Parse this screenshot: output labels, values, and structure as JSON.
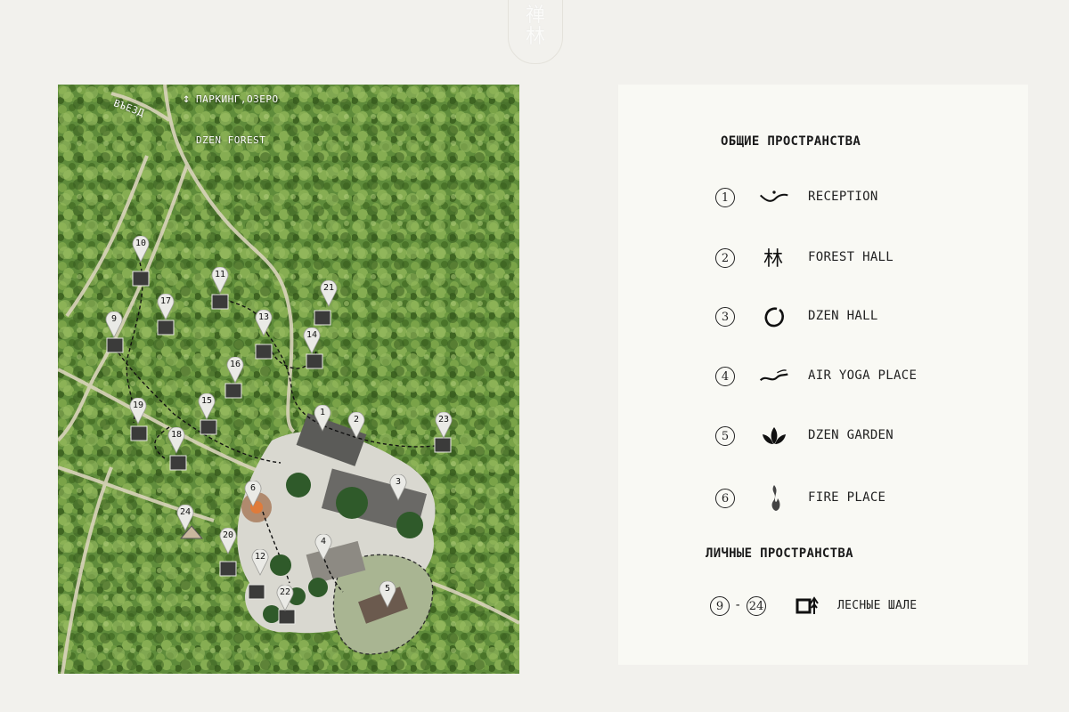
{
  "logo": {
    "line1": "禅",
    "line2": "林"
  },
  "map": {
    "entry_label": "ВЪЕЗД",
    "direction_up": "ПАРКИНГ,ОЗЕРО",
    "direction_down": "DZEN FOREST",
    "markers": [
      "1",
      "2",
      "3",
      "4",
      "5",
      "6",
      "9",
      "10",
      "11",
      "12",
      "13",
      "14",
      "15",
      "16",
      "17",
      "18",
      "19",
      "20",
      "21",
      "22",
      "23",
      "24"
    ]
  },
  "legend": {
    "common_title": "ОБЩИЕ ПРОСТРАНСТВА",
    "items": [
      {
        "num": "1",
        "label": "RECEPTION",
        "icon": "reception-icon"
      },
      {
        "num": "2",
        "label": "FOREST HALL",
        "icon": "forest-hall-icon"
      },
      {
        "num": "3",
        "label": "DZEN HALL",
        "icon": "enso-circle-icon"
      },
      {
        "num": "4",
        "label": "AIR YOGA PLACE",
        "icon": "air-wave-icon"
      },
      {
        "num": "5",
        "label": "DZEN GARDEN",
        "icon": "lotus-icon"
      },
      {
        "num": "6",
        "label": "FIRE PLACE",
        "icon": "flame-icon"
      }
    ],
    "private_title": "ЛИЧНЫЕ ПРОСТРАНСТВА",
    "private": {
      "from": "9",
      "dash": "-",
      "to": "24",
      "label": "ЛЕСНЫЕ ШАЛЕ",
      "icon": "chalet-icon"
    }
  }
}
